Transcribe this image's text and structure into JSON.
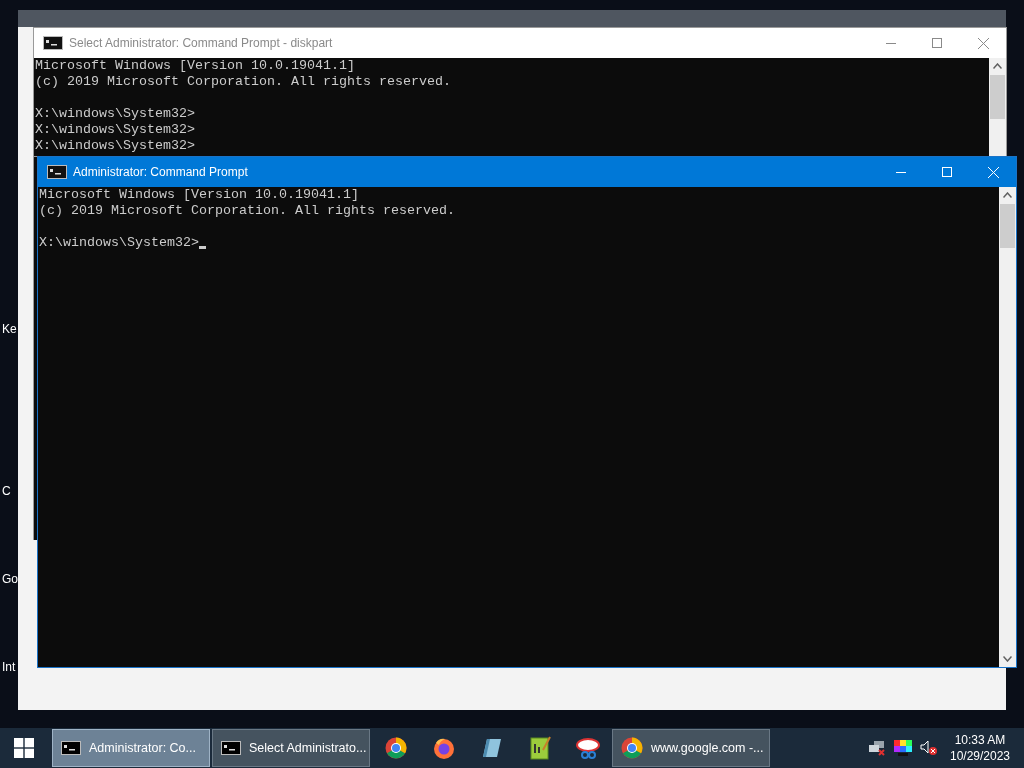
{
  "desktop_icons": [
    {
      "label": "Ke"
    },
    {
      "label": "C"
    },
    {
      "label": "Go"
    },
    {
      "label": "Int"
    }
  ],
  "windows": [
    {
      "title": "Select Administrator: Command Prompt - diskpart",
      "active": false,
      "paragraphs": [
        [
          "Microsoft Windows [Version 10.0.19041.1]",
          "(c) 2019 Microsoft Corporation. All rights reserved."
        ],
        [
          "X:\\windows\\System32>",
          "X:\\windows\\System32>",
          "X:\\windows\\System32>"
        ]
      ]
    },
    {
      "title": "Administrator: Command Prompt",
      "active": true,
      "cursor": true,
      "paragraphs": [
        [
          "Microsoft Windows [Version 10.0.19041.1]",
          "(c) 2019 Microsoft Corporation. All rights reserved."
        ],
        [
          "X:\\windows\\System32>"
        ]
      ]
    }
  ],
  "taskbar": {
    "items": [
      {
        "kind": "console",
        "label": "Administrator: Co...",
        "selected": true
      },
      {
        "kind": "console",
        "label": "Select Administrato...",
        "selected": false
      },
      {
        "kind": "chrome",
        "selected": false
      },
      {
        "kind": "firefox",
        "selected": false
      },
      {
        "kind": "notepad",
        "selected": false
      },
      {
        "kind": "chart",
        "selected": false
      },
      {
        "kind": "snip",
        "selected": false
      },
      {
        "kind": "chrome",
        "label": "www.google.com -...",
        "selected": false
      }
    ],
    "clock": {
      "time": "10:33 AM",
      "date": "10/29/2023"
    }
  }
}
